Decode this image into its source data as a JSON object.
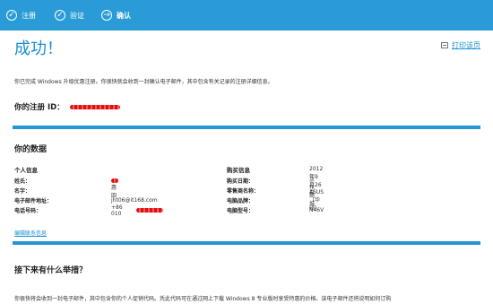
{
  "steps": [
    {
      "label": "注册",
      "icon": "check-icon"
    },
    {
      "label": "验证",
      "icon": "check-icon"
    },
    {
      "label": "确认",
      "icon": "arrow-right-icon"
    }
  ],
  "page": {
    "title": "成功！",
    "print_label": "打印该页",
    "intro": "你已完成 Windows 升级优惠注册。你很快就会收到一封确认电子邮件，其中包含有关记录的注册详细信息。",
    "registration_label": "你的注册 ID："
  },
  "data_section": {
    "title": "你的数据",
    "personal": {
      "heading": "个人信息",
      "rows": [
        {
          "key": "姓氏：",
          "value": ""
        },
        {
          "key": "名字：",
          "value": "惠田"
        },
        {
          "key": "电子邮件地址：",
          "value": "jht06@it168.com"
        },
        {
          "key": "电话号码：",
          "value": "+86 010"
        }
      ]
    },
    "purchase": {
      "heading": "购买信息",
      "rows": [
        {
          "key": "购买日期：",
          "value": "2012年9月26日"
        },
        {
          "key": "零售商名称：",
          "value": "京东商城"
        },
        {
          "key": "电脑品牌：",
          "value": "ASUS（华硕）"
        },
        {
          "key": "电脑型号：",
          "value": "N46V"
        }
      ]
    },
    "edit_link": "编辑联系信息"
  },
  "next_section": {
    "title": "接下来有什么举措？",
    "text": "你很快将会收到一封电子邮件，其中包含你的个人促销代码。凭此代码可在通过网上下载 Windows 8 专业版时享受特惠的价格。该电子邮件还将说明如何订购"
  },
  "colors": {
    "accent": "#1b8fd2",
    "topbar": "#2b9bd7",
    "redaction": "#d11111"
  }
}
